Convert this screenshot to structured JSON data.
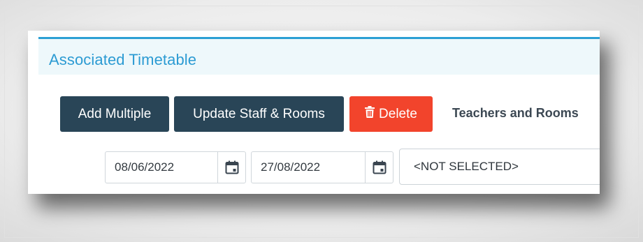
{
  "panel": {
    "title": "Associated Timetable"
  },
  "toolbar": {
    "add_multiple_label": "Add Multiple",
    "update_label": "Update Staff & Rooms",
    "delete_label": "Delete",
    "teachers_rooms_label": "Teachers and Rooms"
  },
  "filters": {
    "start_date": "08/06/2022",
    "end_date": "27/08/2022",
    "selection": "<NOT SELECTED>"
  },
  "colors": {
    "accent": "#2c9bd3",
    "button_dark": "#294557",
    "button_danger": "#f2442c",
    "header_bg": "#eef8fb"
  },
  "icons": {
    "delete": "trash-icon",
    "calendar": "calendar-icon"
  }
}
